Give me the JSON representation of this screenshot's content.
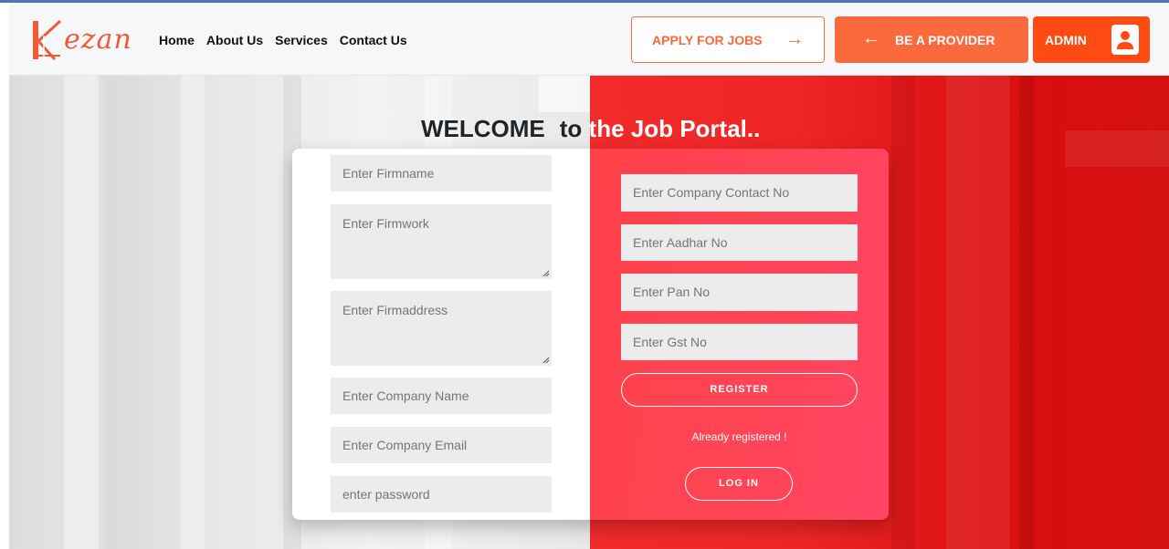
{
  "brand": {
    "logo_text": "ezan",
    "accent": "#ee5a36"
  },
  "nav": {
    "items": [
      {
        "label": "Home"
      },
      {
        "label": "About Us"
      },
      {
        "label": "Services"
      },
      {
        "label": "Contact Us"
      }
    ]
  },
  "header": {
    "apply_label": "APPLY FOR JOBS",
    "apply_icon": "arrow-right-icon",
    "provider_label": "BE A PROVIDER",
    "provider_icon": "arrow-left-icon",
    "admin_label": "ADMIN",
    "admin_icon": "user-icon"
  },
  "hero": {
    "welcome": "WELCOME",
    "subtitle_dark": "to",
    "subtitle_light": " the Job Portal.."
  },
  "form": {
    "left_fields": [
      {
        "placeholder": "Enter Firmname",
        "type": "input"
      },
      {
        "placeholder": "Enter Firmwork",
        "type": "textarea"
      },
      {
        "placeholder": "Enter Firmaddress",
        "type": "textarea"
      },
      {
        "placeholder": "Enter Company Name",
        "type": "input"
      },
      {
        "placeholder": "Enter Company Email",
        "type": "input"
      },
      {
        "placeholder": "enter password",
        "type": "input"
      }
    ],
    "right_fields": [
      {
        "placeholder": "Enter Company Contact No"
      },
      {
        "placeholder": "Enter Aadhar No"
      },
      {
        "placeholder": "Enter Pan No"
      },
      {
        "placeholder": "Enter Gst No"
      }
    ],
    "register_label": "REGISTER",
    "already_text": "Already registered !",
    "login_label": "LOG IN"
  },
  "colors": {
    "left_bg": "#e8e8e8",
    "right_bg": "#ee2626",
    "card_right": "#ff4456",
    "field_bg": "#ececec",
    "admin_btn": "#ff4a12",
    "provider_btn": "#fb6a3c"
  }
}
